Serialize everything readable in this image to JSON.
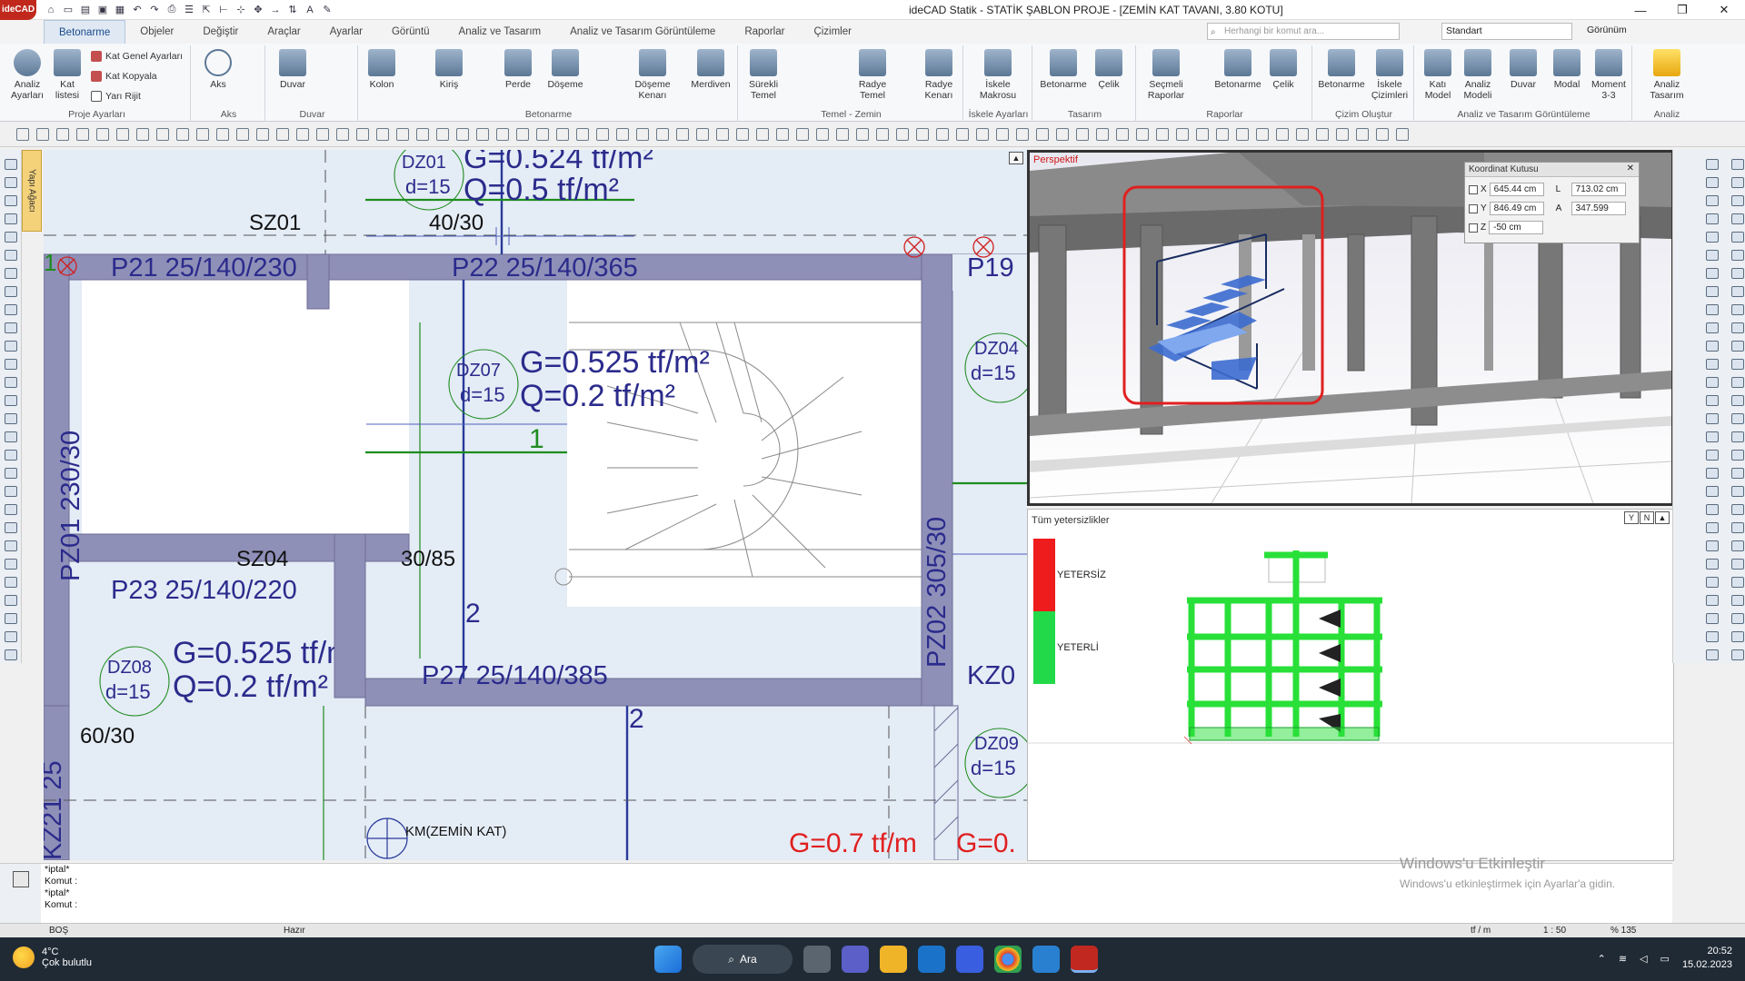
{
  "app": {
    "logo": "ideCAD",
    "title": "ideCAD Statik - STATİK ŞABLON PROJE - [ZEMİN KAT TAVANI,  3.80 KOTU]"
  },
  "menu": {
    "tabs": [
      "Betonarme",
      "Objeler",
      "Değiştir",
      "Araçlar",
      "Ayarlar",
      "Görüntü",
      "Analiz ve Tasarım",
      "Analiz ve Tasarım Görüntüleme",
      "Raporlar",
      "Çizimler"
    ],
    "active": "Betonarme",
    "search_placeholder": "Herhangi bir komut ara...",
    "style_select": "Standart",
    "view_select": "Görünüm"
  },
  "ribbon": {
    "groups": [
      {
        "name": "Proje Ayarları",
        "buttons": [
          "Analiz Ayarları",
          "Kat listesi"
        ],
        "small": [
          "Kat Genel Ayarları",
          "Kat Kopyala",
          "Yarı Rijit"
        ]
      },
      {
        "name": "Aks",
        "buttons": [
          "Aks"
        ]
      },
      {
        "name": "Duvar",
        "buttons": [
          "Duvar"
        ]
      },
      {
        "name": "Betonarme",
        "buttons": [
          "Kolon",
          "Kiriş",
          "Perde",
          "Döşeme",
          "Döşeme Kenarı",
          "Merdiven"
        ]
      },
      {
        "name": "Temel - Zemin",
        "buttons": [
          "Sürekli Temel",
          "Radye Temel",
          "Radye Kenarı"
        ]
      },
      {
        "name": "İskele Ayarları",
        "buttons": [
          "İskele Makrosu"
        ]
      },
      {
        "name": "Tasarım",
        "buttons": [
          "Betonarme",
          "Çelik"
        ]
      },
      {
        "name": "Raporlar",
        "buttons": [
          "Seçmeli Raporlar",
          "Betonarme",
          "Çelik"
        ]
      },
      {
        "name": "Çizim Oluştur",
        "buttons": [
          "Betonarme",
          "İskele Çizimleri"
        ]
      },
      {
        "name": "Analiz ve Tasarım Görüntüleme",
        "buttons": [
          "Katı Model",
          "Analiz Modeli",
          "Duvar",
          "Modal",
          "Moment 3-3"
        ]
      },
      {
        "name": "Analiz",
        "buttons": [
          "Analiz Tasarım"
        ]
      }
    ]
  },
  "side": {
    "left_tab": "Yapı Ağacı"
  },
  "plan": {
    "beams": [
      "SZ01",
      "40/30",
      "P21 25/140/230",
      "P22 25/140/365",
      "P19",
      "SZ04",
      "30/85",
      "P23 25/140/220",
      "P27 25/140/385",
      "KZ0",
      "60/30",
      "PZ01 230/30",
      "PZ02 305/30",
      "KZ21 25"
    ],
    "slabs": [
      {
        "id": "DZ01",
        "d": "d=15",
        "g": "G=0.524 tf/m²",
        "q": "Q=0.5 tf/m²"
      },
      {
        "id": "DZ07",
        "d": "d=15",
        "g": "G=0.525 tf/m²",
        "q": "Q=0.2 tf/m²"
      },
      {
        "id": "DZ08",
        "d": "d=15",
        "g": "G=0.525 tf/m",
        "q": "Q=0.2 tf/m²"
      },
      {
        "id": "DZ04",
        "d": "d=15"
      },
      {
        "id": "DZ09",
        "d": "d=15"
      }
    ],
    "axis_numbers": [
      "1",
      "1",
      "2",
      "2"
    ],
    "km_label": "KM(ZEMİN KAT)",
    "loads": [
      "G=0.7 tf/m",
      "G=0."
    ]
  },
  "view3d": {
    "label": "Perspektif",
    "coord_title": "Koordinat Kutusu",
    "x_label": "X",
    "x": "645.44 cm",
    "y_label": "Y",
    "y": "846.49 cm",
    "z_label": "Z",
    "z": "-50 cm",
    "l_label": "L",
    "l": "713.02 cm",
    "a_label": "A",
    "a": "347.599"
  },
  "results": {
    "title": "Tüm yetersizlikler",
    "legend": [
      {
        "label": "YETERSİZ",
        "color": "#ee1c1c"
      },
      {
        "label": "YETERLİ",
        "color": "#22d94a"
      }
    ],
    "frame_color": "#28e038"
  },
  "command": {
    "lines": [
      "*iptal*",
      "Komut :",
      "*iptal*",
      "Komut :"
    ]
  },
  "status": {
    "mode": "BOŞ",
    "state": "Hazır",
    "unit": "tf / m",
    "scale": "1 : 50",
    "zoom": "% 135"
  },
  "activation": {
    "title": "Windows'u Etkinleştir",
    "subtitle": "Windows'u etkinleştirmek için Ayarlar'a gidin."
  },
  "taskbar": {
    "temp": "4°C",
    "weather": "Çok bulutlu",
    "search": "Ara",
    "time": "20:52",
    "date": "15.02.2023"
  },
  "colors": {
    "accent": "#1a4c8e",
    "beam": "#8f90b8",
    "plan_text": "#2b2b8c",
    "highlight": "#e02020"
  }
}
